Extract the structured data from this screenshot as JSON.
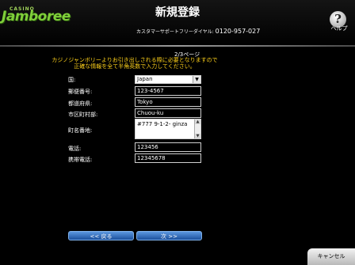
{
  "header": {
    "logo_small": "CASINO",
    "logo_main": "Jamboree",
    "title": "新規登録",
    "support_label": "カスタマーサポートフリーダイヤル:",
    "support_number": "0120-957-027",
    "help_label": "ヘルプ"
  },
  "form": {
    "page_indicator": "2/3ページ",
    "instructions_line1": "カジノジャンボリーよりお引き出しされる際に必要となりますので",
    "instructions_line2": "正確な情報を全て半角英数で入力してください。",
    "country_label": "国:",
    "country_value": "Japan",
    "postal_label": "郵便番号:",
    "postal_value": "123-4567",
    "prefecture_label": "都道府県:",
    "prefecture_value": "Tokyo",
    "city_label": "市区町村部:",
    "city_value": "Chuou-ku",
    "street_label": "町名番地:",
    "street_value": "#777 9-1-2- ginza",
    "phone_label": "電話:",
    "phone_value": "123456",
    "mobile_label": "携帯電話:",
    "mobile_value": "12345678"
  },
  "buttons": {
    "back": "<< 戻る",
    "next": "次 >>",
    "cancel": "キャンセル"
  }
}
